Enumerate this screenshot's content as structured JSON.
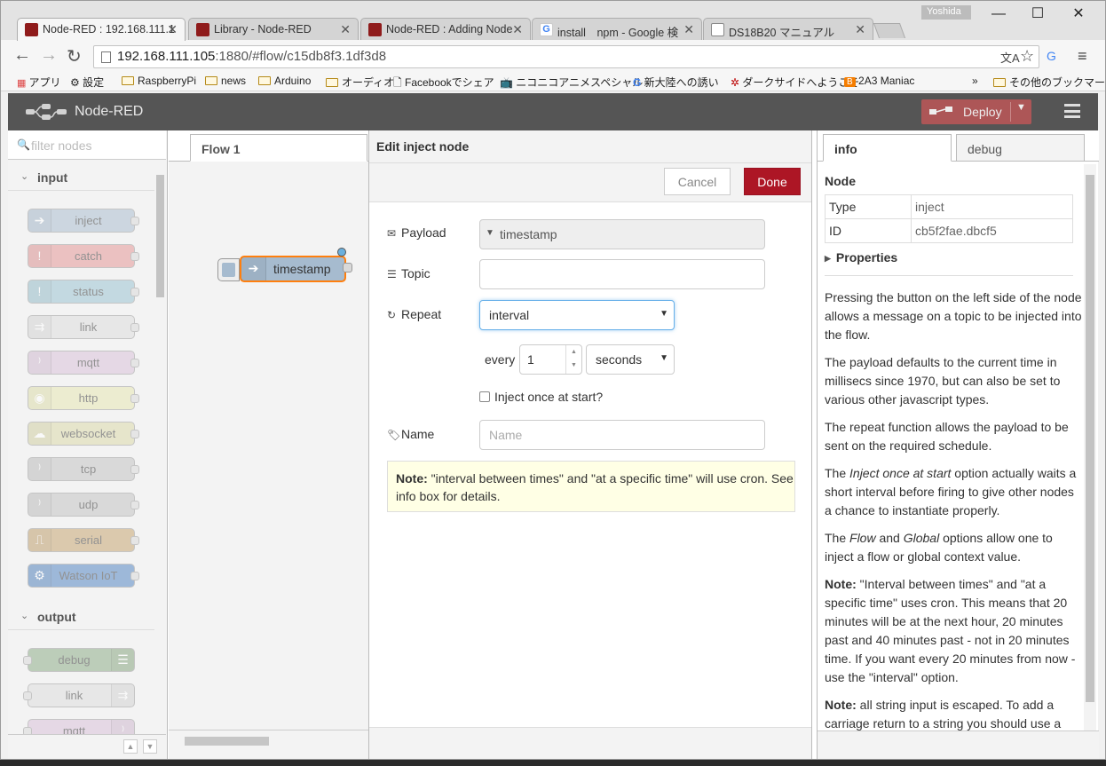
{
  "browser": {
    "user": "Yoshida",
    "tabs": [
      {
        "title": "Node-RED : 192.168.111.1",
        "icon": "node-red-favicon",
        "active": true
      },
      {
        "title": "Library - Node-RED",
        "icon": "node-red-favicon"
      },
      {
        "title": "Node-RED : Adding Node",
        "icon": "node-red-favicon"
      },
      {
        "title": "install　npm - Google 検",
        "icon": "google-favicon"
      },
      {
        "title": "DS18B20 マニュアル",
        "icon": "document-favicon"
      }
    ],
    "url_host": "192.168.111.105",
    "url_rest": ":1880/#flow/c15db8f3.1df3d8",
    "bookmarks": [
      "アプリ",
      "設定",
      "RaspberryPi",
      "news",
      "Arduino",
      "オーディオ",
      "Facebookでシェア",
      "ニコニコアニメスペシャル -",
      "新大陸への誘い",
      "ダークサイドへようこそ",
      "2A3 Maniac"
    ],
    "bookmarks_more": "»",
    "other_bookmarks": "その他のブックマーク"
  },
  "header": {
    "brand": "Node-RED",
    "deploy_label": "Deploy"
  },
  "palette": {
    "filter_placeholder": "filter nodes",
    "input_label": "input",
    "output_label": "output",
    "input_nodes": [
      {
        "label": "inject",
        "color": "#a6bbcf",
        "icon": "arrow-in-icon"
      },
      {
        "label": "catch",
        "color": "#e49191",
        "icon": "exclamation-icon"
      },
      {
        "label": "status",
        "color": "#94c1d0",
        "icon": "exclamation-icon"
      },
      {
        "label": "link",
        "color": "#dddddd",
        "icon": "link-icon"
      },
      {
        "label": "mqtt",
        "color": "#d8bfd8",
        "icon": "bridge-icon"
      },
      {
        "label": "http",
        "color": "#e7e7ae",
        "icon": "globe-icon"
      },
      {
        "label": "websocket",
        "color": "#dbd8a5",
        "icon": "cloud-icon"
      },
      {
        "label": "tcp",
        "color": "#c0c0c0",
        "icon": "bridge-icon"
      },
      {
        "label": "udp",
        "color": "#c0c0c0",
        "icon": "bridge-icon"
      },
      {
        "label": "serial",
        "color": "#c4a16a",
        "icon": "serial-icon"
      },
      {
        "label": "Watson IoT",
        "color": "#4a7fc0",
        "icon": "gear-icon"
      }
    ],
    "output_nodes": [
      {
        "label": "debug",
        "color": "#87a980",
        "icon": "list-icon"
      },
      {
        "label": "link",
        "color": "#dddddd",
        "icon": "link-icon"
      },
      {
        "label": "mqtt",
        "color": "#d8bfd8",
        "icon": "bridge-icon"
      }
    ]
  },
  "workspace": {
    "flow_tab": "Flow 1",
    "node_label": "timestamp"
  },
  "editor": {
    "title": "Edit inject node",
    "cancel": "Cancel",
    "done": "Done",
    "payload_label": "Payload",
    "payload_value": "timestamp",
    "topic_label": "Topic",
    "topic_value": "",
    "repeat_label": "Repeat",
    "repeat_value": "interval",
    "every_label": "every",
    "every_value": "1",
    "unit_value": "seconds",
    "inject_once_label": "Inject once at start?",
    "name_label": "Name",
    "name_placeholder": "Name",
    "note_bold": "Note:",
    "note_text": " \"interval between times\" and \"at a specific time\" will use cron. See info box for details."
  },
  "sidebar": {
    "tab_info": "info",
    "tab_debug": "debug",
    "node_heading": "Node",
    "type_label": "Type",
    "type_value": "inject",
    "id_label": "ID",
    "id_value": "cb5f2fae.dbcf5",
    "properties_label": "Properties",
    "help_1": "Pressing the button on the left side of the node allows a message on a topic to be injected into the flow.",
    "help_2": "The payload defaults to the current time in millisecs since 1970, but can also be set to various other javascript types.",
    "help_3": "The repeat function allows the payload to be sent on the required schedule.",
    "help_4a": "The ",
    "help_4b": "Inject once at start",
    "help_4c": " option actually waits a short interval before firing to give other nodes a chance to instantiate properly.",
    "help_5a": "The ",
    "help_5b": "Flow",
    "help_5c": " and ",
    "help_5d": "Global",
    "help_5e": " options allow one to inject a flow or global context value.",
    "help_6b": "Note:",
    "help_6": " \"Interval between times\" and \"at a specific time\" uses cron. This means that 20 minutes will be at the next hour, 20 minutes past and 40 minutes past - not in 20 minutes time. If you want every 20 minutes from now - use the \"interval\" option.",
    "help_7b": "Note:",
    "help_7": " all string input is escaped. To add a carriage return to a string you should use a"
  },
  "colors": {
    "header": "#555555",
    "deploy": "#ad5657",
    "done": "#ad1625",
    "note_bg": "#ffffe5"
  }
}
